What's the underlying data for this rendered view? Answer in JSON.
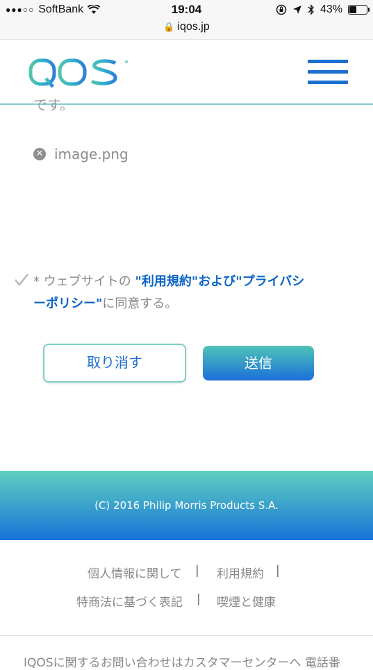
{
  "status_bar": {
    "carrier": "SoftBank",
    "signal_dots": "●●●○○",
    "time": "19:04",
    "battery": "43%",
    "battery_level": 0.43
  },
  "browser": {
    "url": "iqos.jp"
  },
  "header": {
    "logo_text": "IQOS",
    "brand_colors": {
      "teal": "#5fd0c0",
      "blue": "#1a6fcf"
    }
  },
  "form": {
    "cut_off_text": "です。",
    "attachment": {
      "file_name": "image.png"
    },
    "consent": {
      "asterisk": "*",
      "prefix": "ウェブサイトの",
      "terms_link": "\"利用規約\"",
      "and": "および",
      "privacy_link_1": "\"プライバシ",
      "privacy_link_2": "ーポリシー\"",
      "suffix": "に同意する。"
    },
    "cancel_label": "取り消す",
    "submit_label": "送信"
  },
  "footer": {
    "copyright": "(C) 2016 Philip Morris Products S.A.",
    "links": {
      "personal_info": "個人情報に関して",
      "terms": "利用規約",
      "commercial_law": "特商法に基づく表記",
      "smoking_health": "喫煙と健康",
      "separator": "|"
    },
    "contact_text": "IQOSに関するお問い合わせはカスタマーセンターへ 電話番"
  }
}
